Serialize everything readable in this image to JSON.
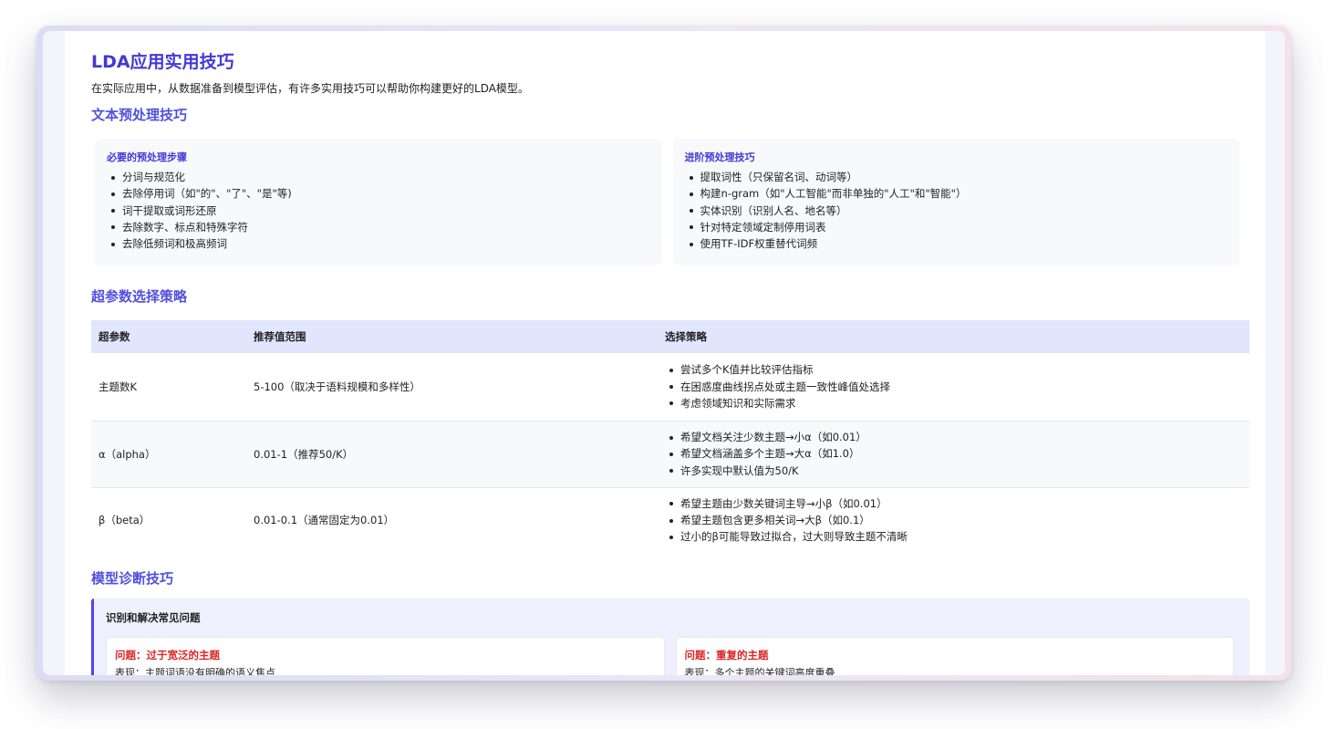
{
  "page": {
    "title": "LDA应用实用技巧",
    "intro": "在实际应用中，从数据准备到模型评估，有许多实用技巧可以帮助你构建更好的LDA模型。"
  },
  "preprocessing": {
    "heading": "文本预处理技巧",
    "cards": [
      {
        "title": "必要的预处理步骤",
        "items": [
          "分词与规范化",
          "去除停用词（如\"的\"、\"了\"、\"是\"等)",
          "词干提取或词形还原",
          "去除数字、标点和特殊字符",
          "去除低频词和极高频词"
        ]
      },
      {
        "title": "进阶预处理技巧",
        "items": [
          "提取词性（只保留名词、动词等）",
          "构建n-gram（如\"人工智能\"而非单独的\"人工\"和\"智能\"）",
          "实体识别（识别人名、地名等）",
          "针对特定领域定制停用词表",
          "使用TF-IDF权重替代词频"
        ]
      }
    ]
  },
  "hyperparams": {
    "heading": "超参数选择策略",
    "columns": [
      "超参数",
      "推荐值范围",
      "选择策略"
    ],
    "rows": [
      {
        "param": "主题数K",
        "range": "5-100（取决于语料规模和多样性）",
        "strategy": [
          "尝试多个K值并比较评估指标",
          "在困惑度曲线拐点处或主题一致性峰值处选择",
          "考虑领域知识和实际需求"
        ]
      },
      {
        "param": "α（alpha）",
        "range": "0.01-1（推荐50/K）",
        "strategy": [
          "希望文档关注少数主题→小α（如0.01）",
          "希望文档涵盖多个主题→大α（如1.0）",
          "许多实现中默认值为50/K"
        ]
      },
      {
        "param": "β（beta）",
        "range": "0.01-0.1（通常固定为0.01）",
        "strategy": [
          "希望主题由少数关键词主导→小β（如0.01）",
          "希望主题包含更多相关词→大β（如0.1）",
          "过小的β可能导致过拟合，过大则导致主题不清晰"
        ]
      }
    ]
  },
  "diagnosis": {
    "heading": "模型诊断技巧",
    "box_title": "识别和解决常见问题",
    "problems": [
      {
        "title": "问题：过于宽泛的主题",
        "desc": "表现：主题词语没有明确的语义焦点"
      },
      {
        "title": "问题：重复的主题",
        "desc": "表现：多个主题的关键词高度重叠"
      }
    ]
  },
  "colors": {
    "accent": "#4338d8",
    "heading": "#5050e0",
    "table_header_bg": "#e1e6fd",
    "diag_box_bg": "#eef1fd",
    "problem_title": "#dc2626"
  }
}
